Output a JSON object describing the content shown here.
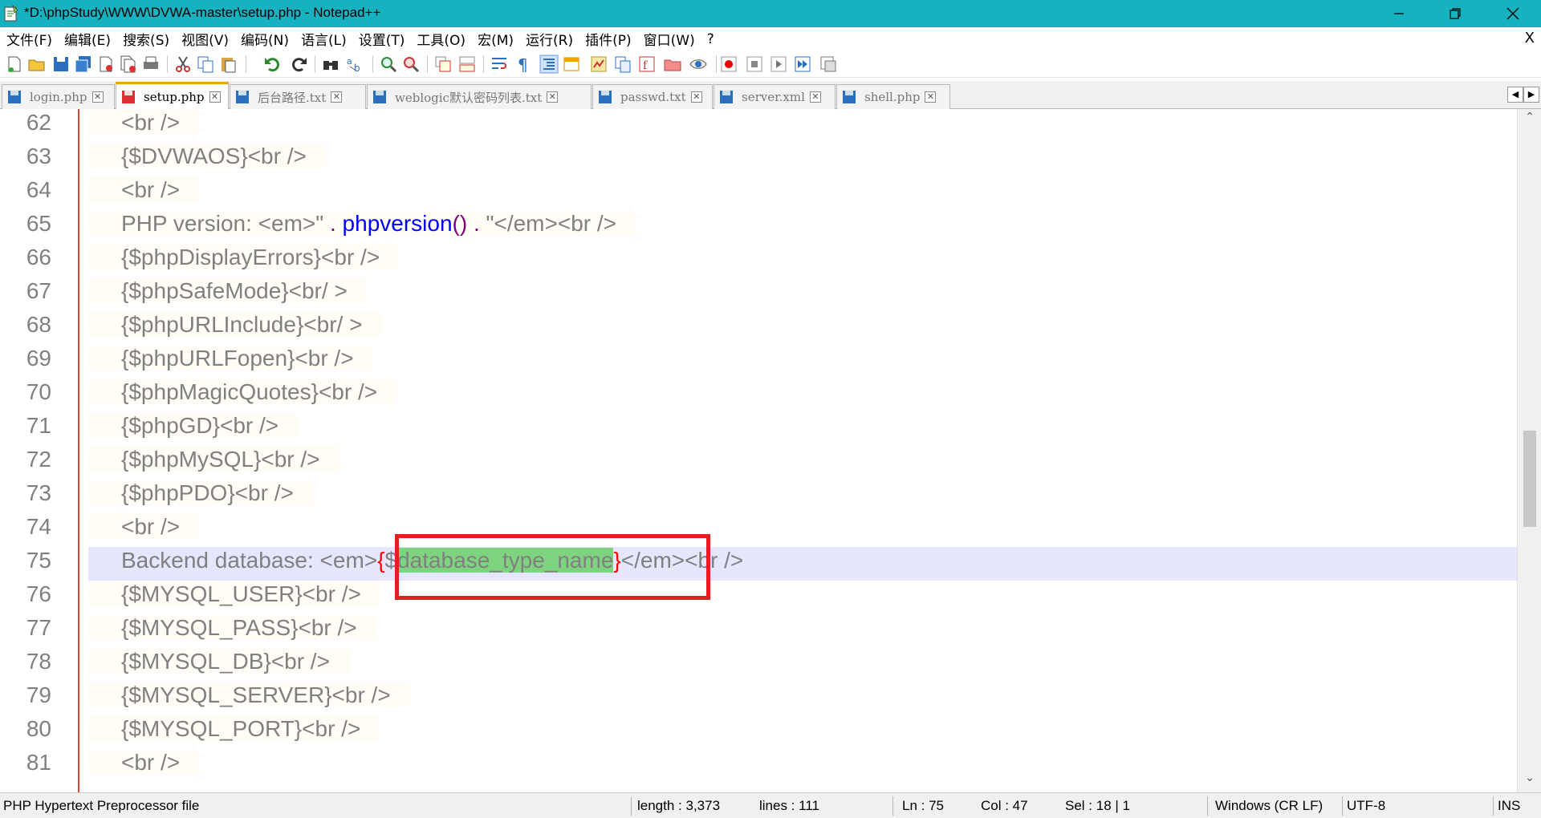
{
  "window": {
    "title": "*D:\\phpStudy\\WWW\\DVWA-master\\setup.php - Notepad++",
    "minimize": "—",
    "restore": "❐",
    "close": "✕"
  },
  "menu": {
    "items": [
      "文件(F)",
      "编辑(E)",
      "搜索(S)",
      "视图(V)",
      "编码(N)",
      "语言(L)",
      "设置(T)",
      "工具(O)",
      "宏(M)",
      "运行(R)",
      "插件(P)",
      "窗口(W)",
      "?"
    ],
    "doc_close": "X"
  },
  "tabs": [
    {
      "label": "login.php",
      "active": false
    },
    {
      "label": "setup.php",
      "active": true
    },
    {
      "label": "后台路径.txt",
      "active": false
    },
    {
      "label": "weblogic默认密码列表.txt",
      "active": false
    },
    {
      "label": "passwd.txt",
      "active": false
    },
    {
      "label": "server.xml",
      "active": false
    },
    {
      "label": "shell.php",
      "active": false
    }
  ],
  "tab_scroll": {
    "left": "◀",
    "right": "▶"
  },
  "editor": {
    "current_line": 75,
    "lines": [
      {
        "n": "62",
        "segs": [
          [
            "s",
            "<br />"
          ]
        ]
      },
      {
        "n": "63",
        "segs": [
          [
            "s",
            "{$DVWAOS}<br />"
          ]
        ]
      },
      {
        "n": "64",
        "segs": [
          [
            "s",
            "<br />"
          ]
        ]
      },
      {
        "n": "65",
        "segs": [
          [
            "s",
            "PHP version: <em>\" "
          ],
          [
            "o",
            "."
          ],
          [
            "s",
            " "
          ],
          [
            "f",
            "phpversion"
          ],
          [
            "o",
            "()"
          ],
          [
            "s",
            " "
          ],
          [
            "o",
            "."
          ],
          [
            "s",
            " \"</em><br />"
          ]
        ]
      },
      {
        "n": "66",
        "segs": [
          [
            "s",
            "{$phpDisplayErrors}<br />"
          ]
        ]
      },
      {
        "n": "67",
        "segs": [
          [
            "s",
            "{$phpSafeMode}<br/ >"
          ]
        ]
      },
      {
        "n": "68",
        "segs": [
          [
            "s",
            "{$phpURLInclude}<br/ >"
          ]
        ]
      },
      {
        "n": "69",
        "segs": [
          [
            "s",
            "{$phpURLFopen}<br />"
          ]
        ]
      },
      {
        "n": "70",
        "segs": [
          [
            "s",
            "{$phpMagicQuotes}<br />"
          ]
        ]
      },
      {
        "n": "71",
        "segs": [
          [
            "s",
            "{$phpGD}<br />"
          ]
        ]
      },
      {
        "n": "72",
        "segs": [
          [
            "s",
            "{$phpMySQL}<br />"
          ]
        ]
      },
      {
        "n": "73",
        "segs": [
          [
            "s",
            "{$phpPDO}<br />"
          ]
        ]
      },
      {
        "n": "74",
        "segs": [
          [
            "s",
            "<br />"
          ]
        ]
      },
      {
        "n": "75",
        "segs": [
          [
            "s",
            "Backend database: <em>"
          ],
          [
            "r",
            "{"
          ],
          [
            "s",
            "$"
          ],
          [
            "h",
            "database_type_name"
          ],
          [
            "r",
            "}"
          ],
          [
            "s",
            "</em><br />"
          ]
        ]
      },
      {
        "n": "76",
        "segs": [
          [
            "s",
            "{$MYSQL_USER}<br />"
          ]
        ]
      },
      {
        "n": "77",
        "segs": [
          [
            "s",
            "{$MYSQL_PASS}<br />"
          ]
        ]
      },
      {
        "n": "78",
        "segs": [
          [
            "s",
            "{$MYSQL_DB}<br />"
          ]
        ]
      },
      {
        "n": "79",
        "segs": [
          [
            "s",
            "{$MYSQL_SERVER}<br />"
          ]
        ]
      },
      {
        "n": "80",
        "segs": [
          [
            "s",
            "{$MYSQL_PORT}<br />"
          ]
        ]
      },
      {
        "n": "81",
        "segs": [
          [
            "s",
            "<br />"
          ]
        ]
      }
    ]
  },
  "scrollbar": {
    "up": "⌃",
    "down": "⌄"
  },
  "status": {
    "file_type": "PHP Hypertext Preprocessor file",
    "length": "length : 3,373",
    "lines": "lines : 111",
    "ln": "Ln : 75",
    "col": "Col : 47",
    "sel": "Sel : 18 | 1",
    "eol": "Windows (CR LF)",
    "encoding": "UTF-8",
    "mode": "INS"
  },
  "colors": {
    "titlebar": "#17b2c0",
    "selection": "#7ed47e",
    "current_line": "#e6e6ff",
    "annotation_box": "#e02020"
  }
}
